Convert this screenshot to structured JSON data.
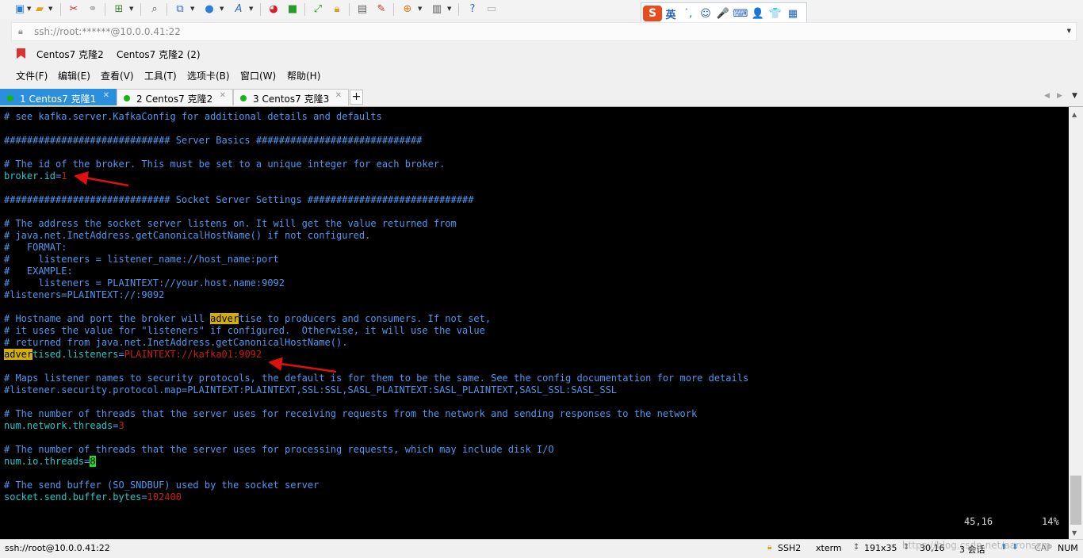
{
  "toolbar": {
    "icons": [
      "new-session-icon",
      "open-folder-icon",
      "disconnect-icon",
      "reconnect-icon",
      "new-window-icon",
      "find-icon",
      "sftp-icon",
      "globe-icon",
      "font-icon",
      "xshell-icon",
      "xftp-icon",
      "fullscreen-icon",
      "lock-icon",
      "keyboard-icon",
      "compose-icon",
      "add-tab-icon",
      "layout-icon",
      "help-icon",
      "chat-icon"
    ]
  },
  "ime": {
    "logo": "S",
    "mode": "英",
    "items": [
      "˙,",
      "☺",
      "🎤",
      "⌨",
      "👤",
      "👕",
      "▦"
    ]
  },
  "address": {
    "value": "ssh://root:******@10.0.0.41:22"
  },
  "bookmarks": [
    {
      "label": "Centos7 克隆2"
    },
    {
      "label": "Centos7 克隆2 (2)"
    }
  ],
  "menu": [
    "文件(F)",
    "编辑(E)",
    "查看(V)",
    "工具(T)",
    "选项卡(B)",
    "窗口(W)",
    "帮助(H)"
  ],
  "tabs": [
    {
      "label": "1 Centos7 克隆1",
      "active": true
    },
    {
      "label": "2 Centos7 克隆2",
      "active": false
    },
    {
      "label": "3 Centos7 克隆3",
      "active": false
    }
  ],
  "terminal": {
    "lines": [
      [
        {
          "t": "# see kafka.server.KafkaConfig for additional details and defaults",
          "c": "comment"
        }
      ],
      [],
      [
        {
          "t": "############################# Server Basics #############################",
          "c": "comment"
        }
      ],
      [],
      [
        {
          "t": "# The id of the broker. This must be set to a unique integer for each broker.",
          "c": "comment"
        }
      ],
      [
        {
          "t": "broker.id",
          "c": "key"
        },
        {
          "t": "=",
          "c": "comment"
        },
        {
          "t": "1",
          "c": "val"
        }
      ],
      [],
      [
        {
          "t": "############################# Socket Server Settings #############################",
          "c": "comment"
        }
      ],
      [],
      [
        {
          "t": "# The address the socket server listens on. It will get the value returned from",
          "c": "comment"
        }
      ],
      [
        {
          "t": "# java.net.InetAddress.getCanonicalHostName() if not configured.",
          "c": "comment"
        }
      ],
      [
        {
          "t": "#   FORMAT:",
          "c": "comment"
        }
      ],
      [
        {
          "t": "#     listeners = listener_name://host_name:port",
          "c": "comment"
        }
      ],
      [
        {
          "t": "#   EXAMPLE:",
          "c": "comment"
        }
      ],
      [
        {
          "t": "#     listeners = PLAINTEXT://your.host.name:9092",
          "c": "comment"
        }
      ],
      [
        {
          "t": "#listeners=PLAINTEXT://:9092",
          "c": "comment"
        }
      ],
      [],
      [
        {
          "t": "# Hostname and port the broker will ",
          "c": "comment"
        },
        {
          "t": "adver",
          "c": "hl"
        },
        {
          "t": "tise to producers and consumers. If not set,",
          "c": "comment"
        }
      ],
      [
        {
          "t": "# it uses the value for \"listeners\" if configured.  Otherwise, it will use the value",
          "c": "comment"
        }
      ],
      [
        {
          "t": "# returned from java.net.InetAddress.getCanonicalHostName().",
          "c": "comment"
        }
      ],
      [
        {
          "t": "adver",
          "c": "hl"
        },
        {
          "t": "tised.listeners",
          "c": "key"
        },
        {
          "t": "=",
          "c": "comment"
        },
        {
          "t": "PLAINTEXT://kafka01:9092",
          "c": "val"
        }
      ],
      [],
      [
        {
          "t": "# Maps listener names to security protocols, the default is for them to be the same. See the config documentation for more details",
          "c": "comment"
        }
      ],
      [
        {
          "t": "#listener.security.protocol.map=PLAINTEXT:PLAINTEXT,SSL:SSL,SASL_PLAINTEXT:SASL_PLAINTEXT,SASL_SSL:SASL_SSL",
          "c": "comment"
        }
      ],
      [],
      [
        {
          "t": "# The number of threads that the server uses for receiving requests from the network and sending responses to the network",
          "c": "comment"
        }
      ],
      [
        {
          "t": "num.network.threads",
          "c": "key"
        },
        {
          "t": "=",
          "c": "comment"
        },
        {
          "t": "3",
          "c": "val"
        }
      ],
      [],
      [
        {
          "t": "# The number of threads that the server uses for processing requests, which may include disk I/O",
          "c": "comment"
        }
      ],
      [
        {
          "t": "num.io.threads",
          "c": "key"
        },
        {
          "t": "=",
          "c": "comment"
        },
        {
          "t": "8",
          "c": "cursor"
        }
      ],
      [],
      [
        {
          "t": "# The send buffer (SO_SNDBUF) used by the socket server",
          "c": "comment"
        }
      ],
      [
        {
          "t": "socket.send.buffer.bytes",
          "c": "key"
        },
        {
          "t": "=",
          "c": "comment"
        },
        {
          "t": "102400",
          "c": "val"
        }
      ]
    ],
    "position": "45,16",
    "percent": "14%"
  },
  "status": {
    "connection": "ssh://root@10.0.0.41:22",
    "protocol": "SSH2",
    "term": "xterm",
    "size": "191x35",
    "cursor": "30,16",
    "sessions": "3 会话",
    "caps": "CAP",
    "num": "NUM",
    "watermark": "https://blog.csdn.net/aaronszm"
  },
  "colors": {
    "comment": "#4d98f0",
    "key": "#22c8c8",
    "value": "#c81e1e",
    "highlight": "#d4b000",
    "cursor": "#20e020",
    "tab_active": "#2b8fe0",
    "arrow": "#e01010"
  }
}
